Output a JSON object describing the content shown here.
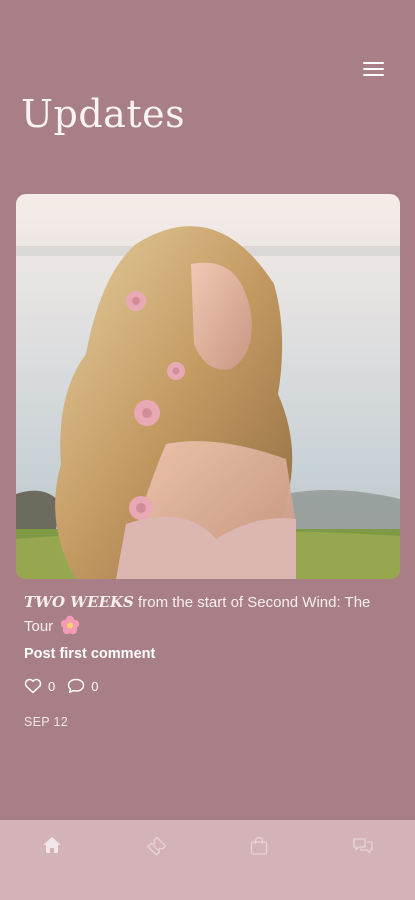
{
  "header": {
    "title": "Updates",
    "menu_icon": "hamburger-menu-icon"
  },
  "post": {
    "text_emphasis": "TWO WEEKS",
    "text_rest": " from the start of Second Wind: The Tour",
    "emoji": "🌸",
    "first_comment_label": "Post first comment",
    "likes": "0",
    "comments": "0",
    "date": "SEP 12"
  },
  "bottom_nav": {
    "items": [
      {
        "icon": "home-icon",
        "active": true
      },
      {
        "icon": "ticket-icon",
        "active": false
      },
      {
        "icon": "shopping-bag-icon",
        "active": false
      },
      {
        "icon": "chat-icon",
        "active": false
      }
    ]
  },
  "colors": {
    "background": "#a87f86",
    "bottom_nav": "#d4b3b8",
    "text": "#ffffff"
  }
}
